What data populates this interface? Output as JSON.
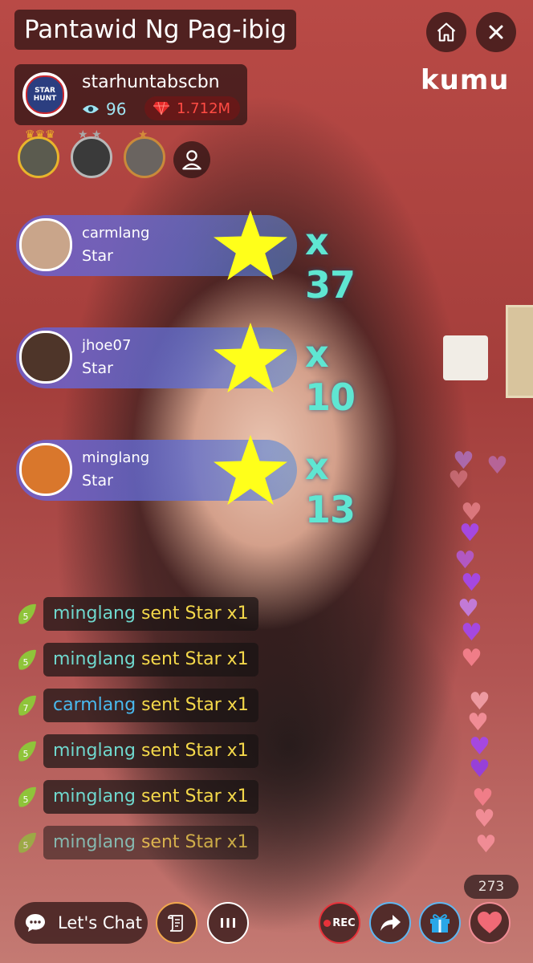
{
  "stream": {
    "title": "Pantawid Ng Pag-ibig",
    "brand": "kumu"
  },
  "host": {
    "name": "starhuntabscbn",
    "avatar_text": "STAR HUNT",
    "viewers": "96",
    "coins": "1.712M"
  },
  "top_fans": [
    {
      "rank": "gold"
    },
    {
      "rank": "silver"
    },
    {
      "rank": "bronze"
    }
  ],
  "gifts": [
    {
      "user": "carmlang",
      "gift": "Star",
      "count": "x 37"
    },
    {
      "user": "jhoe07",
      "gift": "Star",
      "count": "x 10"
    },
    {
      "user": "minglang",
      "gift": "Star",
      "count": "x 13"
    }
  ],
  "feed": [
    {
      "level": "5",
      "user": "minglang",
      "text": "sent Star x1"
    },
    {
      "level": "5",
      "user": "minglang",
      "text": "sent Star x1"
    },
    {
      "level": "7",
      "user": "carmlang",
      "text": "sent Star x1"
    },
    {
      "level": "5",
      "user": "minglang",
      "text": "sent Star x1"
    },
    {
      "level": "5",
      "user": "minglang",
      "text": "sent Star x1"
    },
    {
      "level": "5",
      "user": "minglang",
      "text": "sent Star x1"
    }
  ],
  "bottom_bar": {
    "chat_label": "Let's Chat",
    "rec_label": "REC",
    "like_count": "273"
  },
  "colors": {
    "accent_heart": "#f08c95",
    "gift_count": "#5fe6d2",
    "coin": "#ff4b43"
  },
  "icons": [
    "home-icon",
    "close-icon",
    "eye-icon",
    "diamond-icon",
    "add-user-icon",
    "star-icon",
    "leaf-level-icon",
    "chat-bubble-icon",
    "scroll-icon",
    "more-icon",
    "record-icon",
    "share-icon",
    "gift-icon",
    "heart-icon"
  ]
}
